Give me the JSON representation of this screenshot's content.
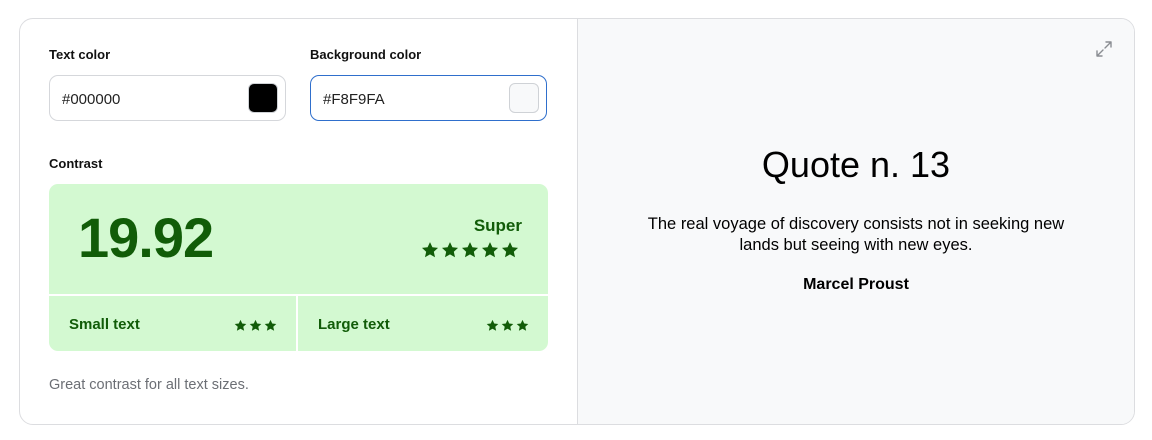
{
  "text_color": {
    "label": "Text color",
    "value": "#000000"
  },
  "background_color": {
    "label": "Background color",
    "value": "#F8F9FA"
  },
  "contrast": {
    "label": "Contrast",
    "ratio": "19.92",
    "rating": "Super",
    "rating_stars": 5,
    "small_text": {
      "label": "Small text",
      "stars": 3
    },
    "large_text": {
      "label": "Large text",
      "stars": 3
    },
    "summary": "Great contrast for all text sizes."
  },
  "preview": {
    "title": "Quote n. 13",
    "quote": "The real voyage of discovery consists not in seeking new lands but seeing with new eyes.",
    "author": "Marcel Proust"
  },
  "colors": {
    "result_bg": "#d3f9d1",
    "result_fg": "#115c08",
    "focus_border": "#2f6fcc",
    "preview_bg": "#F8F9FA",
    "preview_fg": "#000000"
  },
  "icons": {
    "expand": "expand-icon",
    "star": "star-icon"
  }
}
